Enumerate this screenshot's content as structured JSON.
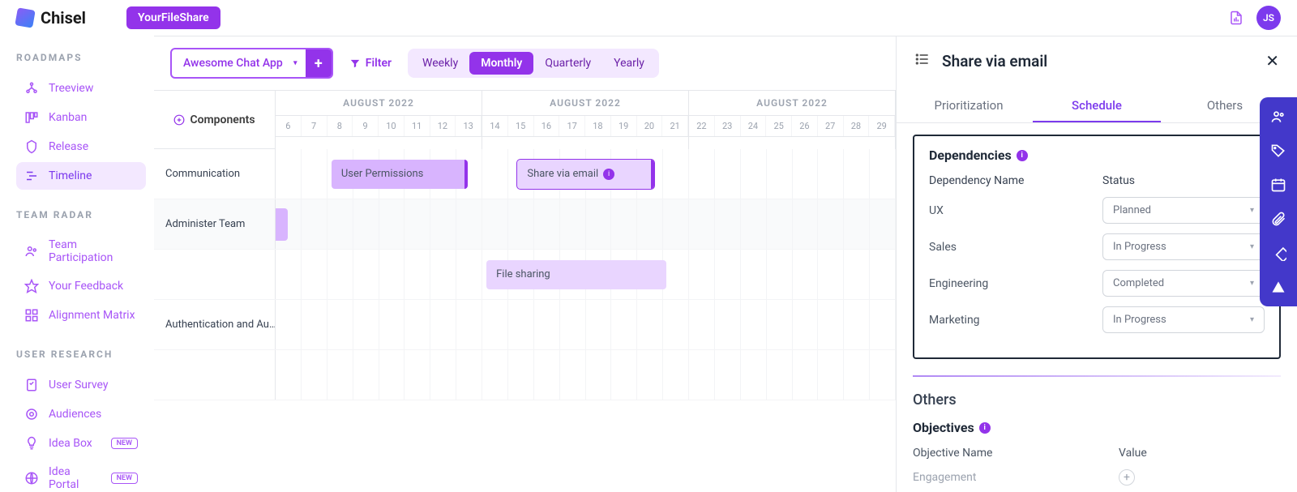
{
  "brand": "Chisel",
  "header": {
    "badge": "YourFileShare",
    "avatar": "JS"
  },
  "sidebar": {
    "sections": [
      {
        "heading": "ROADMAPS",
        "items": [
          {
            "label": "Treeview"
          },
          {
            "label": "Kanban"
          },
          {
            "label": "Release"
          },
          {
            "label": "Timeline",
            "active": true
          }
        ]
      },
      {
        "heading": "TEAM RADAR",
        "items": [
          {
            "label": "Team Participation"
          },
          {
            "label": "Your Feedback"
          },
          {
            "label": "Alignment Matrix"
          }
        ]
      },
      {
        "heading": "USER RESEARCH",
        "items": [
          {
            "label": "User Survey"
          },
          {
            "label": "Audiences"
          },
          {
            "label": "Idea Box",
            "badge": "NEW"
          },
          {
            "label": "Idea Portal",
            "badge": "NEW"
          }
        ]
      }
    ]
  },
  "toolbar": {
    "workspace": "Awesome Chat App",
    "filter": "Filter",
    "views": [
      "Weekly",
      "Monthly",
      "Quarterly",
      "Yearly"
    ],
    "active_view": "Monthly"
  },
  "timeline": {
    "corner": "Components",
    "months": [
      "AUGUST 2022",
      "AUGUST 2022",
      "AUGUST 2022"
    ],
    "days": [
      "6",
      "7",
      "8",
      "9",
      "10",
      "11",
      "12",
      "13",
      "14",
      "15",
      "16",
      "17",
      "18",
      "19",
      "20",
      "21",
      "22",
      "23",
      "24",
      "25",
      "26",
      "27",
      "28",
      "29"
    ],
    "rows": [
      {
        "label": "Communication",
        "bars": [
          {
            "text": "User Permissions",
            "left_pct": 9,
            "width_pct": 22,
            "cls": "mid"
          },
          {
            "text": "Share via email",
            "left_pct": 39,
            "width_pct": 22,
            "cls": "sel",
            "info": true
          }
        ]
      },
      {
        "label": "Administer Team",
        "striped": true,
        "frag": {
          "left_pct": 0,
          "width_pct": 2
        }
      },
      {
        "label": "",
        "bars": [
          {
            "text": "File sharing",
            "left_pct": 34,
            "width_pct": 29,
            "cls": "light"
          }
        ]
      },
      {
        "label": "Authentication and Au…"
      },
      {
        "label": ""
      }
    ]
  },
  "panel": {
    "title": "Share via email",
    "tabs": [
      "Prioritization",
      "Schedule",
      "Others"
    ],
    "active_tab": "Schedule",
    "dependencies": {
      "heading": "Dependencies",
      "col_name": "Dependency Name",
      "col_status": "Status",
      "items": [
        {
          "name": "UX",
          "status": "Planned"
        },
        {
          "name": "Sales",
          "status": "In Progress"
        },
        {
          "name": "Engineering",
          "status": "Completed"
        },
        {
          "name": "Marketing",
          "status": "In Progress"
        }
      ]
    },
    "others": {
      "heading": "Others"
    },
    "objectives": {
      "heading": "Objectives",
      "col_name": "Objective Name",
      "col_value": "Value",
      "first": "Engagement"
    }
  }
}
